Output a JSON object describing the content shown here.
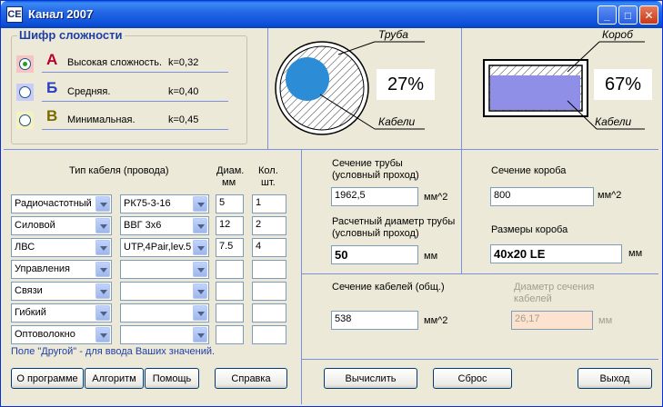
{
  "window": {
    "title": "Канал 2007",
    "icon_text": "СЕ",
    "minimize": "_",
    "maximize": "□",
    "close": "✕"
  },
  "complexity": {
    "title": "Шифр сложности",
    "options": [
      {
        "letter": "А",
        "label": "Высокая сложность.",
        "k": "k=0,32",
        "color": "#B8002E",
        "checked": true
      },
      {
        "letter": "Б",
        "label": "Средняя.",
        "k": "k=0,40",
        "color": "#2A3EC6",
        "checked": false
      },
      {
        "letter": "В",
        "label": "Минимальная.",
        "k": "k=0,45",
        "color": "#7A6A00",
        "checked": false
      }
    ]
  },
  "pipe_diagram": {
    "label_pipe": "Труба",
    "label_cables": "Кабели",
    "percent": "27%",
    "fill_ratio": 0.27
  },
  "box_diagram": {
    "label_box": "Короб",
    "label_cables": "Кабели",
    "percent": "67%",
    "fill_ratio": 0.67
  },
  "cables_table": {
    "header_type": "Тип кабеля (провода)",
    "header_diam": "Диам.",
    "header_diam_unit": "мм",
    "header_qty": "Кол.",
    "header_qty_unit": "шт.",
    "rows": [
      {
        "type": "Радиочастотный",
        "mark": "РК75-3-16",
        "diam": "5",
        "qty": "1"
      },
      {
        "type": "Силовой",
        "mark": "ВВГ 3х6",
        "diam": "12",
        "qty": "2"
      },
      {
        "type": "ЛВС",
        "mark": "UTP,4Pair,lev.5",
        "diam": "7.5",
        "qty": "4"
      },
      {
        "type": "Управления",
        "mark": "",
        "diam": "",
        "qty": ""
      },
      {
        "type": "Связи",
        "mark": "",
        "diam": "",
        "qty": ""
      },
      {
        "type": "Гибкий",
        "mark": "",
        "diam": "",
        "qty": ""
      },
      {
        "type": "Оптоволокно",
        "mark": "",
        "diam": "",
        "qty": ""
      }
    ],
    "hint": "Поле \"Другой\" - для ввода Ваших значений."
  },
  "pipe_section": {
    "label_line1": "Сечение трубы",
    "label_line2": "(условный проход)",
    "value": "1962,5",
    "unit": "мм^2"
  },
  "pipe_diameter": {
    "label_line1": "Расчетный диаметр трубы",
    "label_line2": "(условный проход)",
    "value": "50",
    "unit": "мм"
  },
  "box_section": {
    "label": "Сечение короба",
    "value": "800",
    "unit": "мм^2"
  },
  "box_size": {
    "label": "Размеры короба",
    "value": "40х20 LE",
    "unit": "мм"
  },
  "cables_section": {
    "label": "Сечение кабелей (общ.)",
    "value": "538",
    "unit": "мм^2"
  },
  "cable_diameter": {
    "label_line1": "Диаметр сечения",
    "label_line2": "кабелей",
    "value": "26,17",
    "unit": "мм"
  },
  "buttons": {
    "about": "О программе",
    "algorithm": "Алгоритм",
    "help": "Помощь",
    "reference": "Справка",
    "calculate": "Вычислить",
    "reset": "Сброс",
    "exit": "Выход"
  }
}
